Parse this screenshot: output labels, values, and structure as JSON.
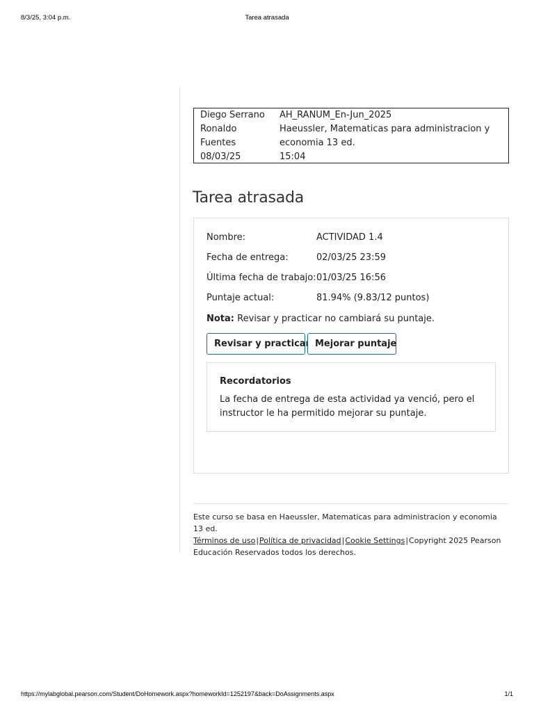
{
  "print_header": {
    "datetime": "8/3/25, 3:04 p.m.",
    "title": "Tarea atrasada"
  },
  "info": {
    "student_name_line1": "Diego Serrano",
    "student_name_line2": "Ronaldo",
    "student_name_line3": "Fuentes",
    "date": "08/03/25",
    "course_code": "AH_RANUM_En-Jun_2025",
    "book": "Haeussler, Matematicas para administracion y economia 13 ed.",
    "time": "15:04"
  },
  "page_title": "Tarea atrasada",
  "assignment": {
    "fields": [
      {
        "label": "Nombre:",
        "value": "ACTIVIDAD 1.4"
      },
      {
        "label": "Fecha de entrega:",
        "value": "02/03/25 23:59"
      },
      {
        "label": "Última fecha de trabajo:",
        "value": "01/03/25 16:56"
      },
      {
        "label": "Puntaje actual:",
        "value": "81.94% (9.83/12 puntos)"
      }
    ],
    "note_label": "Nota:",
    "note_text": "Revisar y practicar no cambiará su puntaje."
  },
  "buttons": {
    "review": "Revisar y practicar",
    "improve": "Mejorar puntaje"
  },
  "reminders": {
    "title": "Recordatorios",
    "text": "La fecha de entrega de esta actividad ya venció, pero el instructor le ha permitido mejorar su puntaje."
  },
  "footer": {
    "course_basis": "Este curso se basa en Haeussler, Matematicas para administracion y economia 13 ed.",
    "terms": "Términos de uso",
    "privacy": "Política de privacidad",
    "cookies": "Cookie Settings",
    "copyright": "Copyright 2025 Pearson Educación Reservados todos los derechos.",
    "separator": "|"
  },
  "print_footer": {
    "url": "https://mylabglobal.pearson.com/Student/DoHomework.aspx?homeworkId=1252197&back=DoAssignments.aspx",
    "page": "1/1"
  }
}
